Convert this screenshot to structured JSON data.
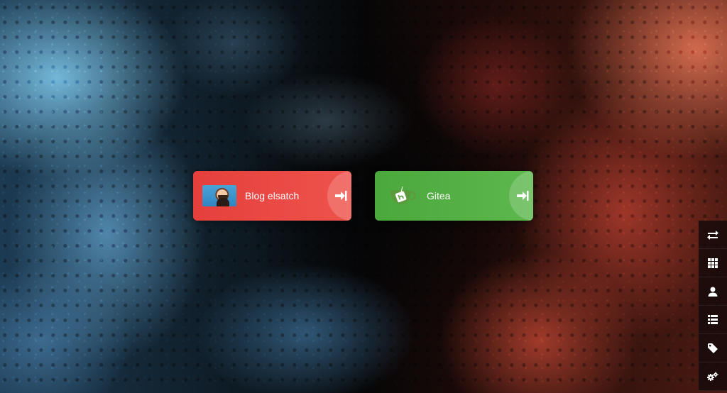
{
  "background": {
    "colors": {
      "left": "#3a85b5",
      "center": "#060607",
      "right": "#c9553f"
    }
  },
  "apps": [
    {
      "label": "Blog elsatch",
      "color": "#e9463f",
      "icon": "avatar-photo",
      "action_icon": "arrow-to-right-icon"
    },
    {
      "label": "Gitea",
      "color": "#54b045",
      "icon": "gitea-teacup-icon",
      "action_icon": "arrow-to-right-icon"
    }
  ],
  "sidebar": {
    "items": [
      {
        "icon": "exchange-arrows-icon"
      },
      {
        "icon": "grid-icon"
      },
      {
        "icon": "user-icon"
      },
      {
        "icon": "list-icon"
      },
      {
        "icon": "tag-icon"
      },
      {
        "icon": "cogs-icon"
      }
    ]
  }
}
